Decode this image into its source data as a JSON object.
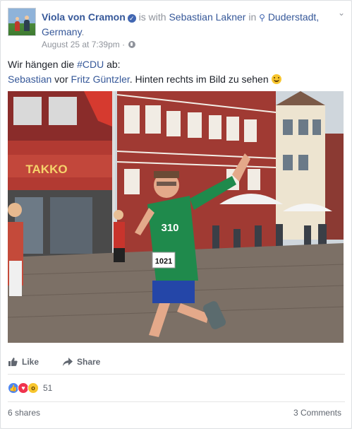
{
  "post": {
    "author": "Viola von Cramon",
    "is_with": "is with",
    "tagged_person": "Sebastian Lakner",
    "in_word": "in",
    "location": "Duderstadt, Germany",
    "period": ".",
    "timestamp": "August 25 at 7:39pm",
    "separator": "·",
    "text_line1_prefix": "Wir hängen die ",
    "hashtag": "#CDU",
    "text_line1_suffix": " ab:",
    "mention1": "Sebastian",
    "text_vor": " vor ",
    "mention2": "Fritz Güntzler",
    "text_line2_suffix": ". Hinten rechts im Bild zu sehen ",
    "emoji": "smiley-emoji"
  },
  "photo": {
    "shop_sign": "TAKKO",
    "bib_number": "1021",
    "shirt_text": "310"
  },
  "actions": {
    "like_label": "Like",
    "share_label": "Share"
  },
  "reactions": {
    "count": "51",
    "types": [
      "like",
      "love",
      "wow"
    ]
  },
  "footer": {
    "shares": "6 shares",
    "comments": "3 Comments"
  },
  "colors": {
    "link": "#365899",
    "muted": "#90949c",
    "action": "#616770",
    "like_reaction": "#4e86f2",
    "love_reaction": "#f0344e",
    "wow_reaction": "#f7c52e"
  }
}
